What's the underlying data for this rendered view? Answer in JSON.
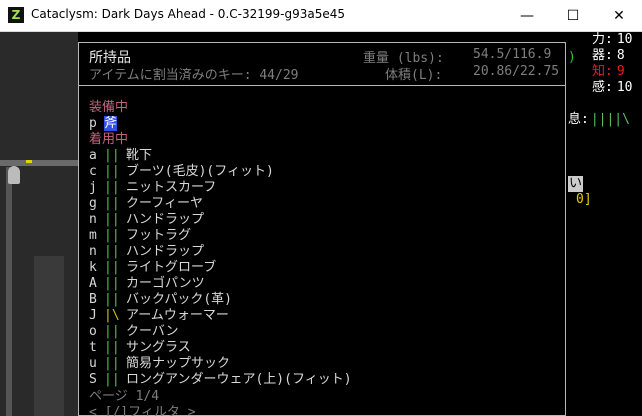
{
  "window": {
    "title": "Cataclysm: Dark Days Ahead - 0.C-32199-g93a5e45",
    "icon_letter": "Z",
    "minimize": "—",
    "maximize": "☐",
    "close": "✕"
  },
  "inventory": {
    "title": "所持品",
    "weight_label": "重量 (lbs):",
    "weight_value": "54.5/116.9",
    "assigned_keys": "アイテムに割当済みのキー: 44/29",
    "volume_label": "体積(L):",
    "volume_value": "20.86/22.75",
    "wielded_header": "装備中",
    "wielded": {
      "key": "p",
      "name": "斧"
    },
    "worn_header": "着用中",
    "worn_items": [
      {
        "key": "a",
        "bar": "||",
        "name": "靴下"
      },
      {
        "key": "c",
        "bar": "||",
        "name": "ブーツ(毛皮)(フィット)"
      },
      {
        "key": "j",
        "bar": "||",
        "name": "ニットスカーフ"
      },
      {
        "key": "g",
        "bar": "||",
        "name": "クーフィーヤ"
      },
      {
        "key": "n",
        "bar": "||",
        "name": "ハンドラップ"
      },
      {
        "key": "m",
        "bar": "||",
        "name": "フットラグ"
      },
      {
        "key": "n",
        "bar": "||",
        "name": "ハンドラップ"
      },
      {
        "key": "k",
        "bar": "||",
        "name": "ライトグローブ"
      },
      {
        "key": "A",
        "bar": "||",
        "name": "カーゴパンツ"
      },
      {
        "key": "B",
        "bar": "||",
        "name": "バックパック(革)"
      },
      {
        "key": "J",
        "bar": "|\\",
        "name": "アームウォーマー"
      },
      {
        "key": "o",
        "bar": "||",
        "name": "クーバン"
      },
      {
        "key": "t",
        "bar": "||",
        "name": "サングラス"
      },
      {
        "key": "u",
        "bar": "||",
        "name": "簡易ナップサック"
      },
      {
        "key": "S",
        "bar": "||",
        "name": "ロングアンダーウェア(上)(フィット)"
      }
    ],
    "page": "ページ 1/4",
    "filter": "< [/]フィルタ >"
  },
  "sidebar": {
    "stats": [
      {
        "label": "力:",
        "value": "10",
        "color": "#ffffff"
      },
      {
        "label": "器:",
        "value": "8",
        "color": "#ffffff"
      },
      {
        "label": "知:",
        "value": "9",
        "color": "#e02020"
      },
      {
        "label": "感:",
        "value": "10",
        "color": "#ffffff"
      }
    ],
    "breath_label": "息:",
    "breath_bar": "||||\\",
    "partial_paren": ")",
    "small_tag": "い",
    "small_value": "0]"
  }
}
